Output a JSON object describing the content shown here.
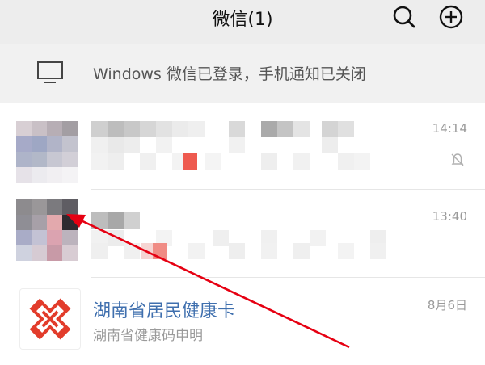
{
  "header": {
    "title": "微信(1)",
    "search_icon": "search-icon",
    "add_icon": "plus-circle-icon"
  },
  "banner": {
    "icon": "monitor-icon",
    "text": "Windows 微信已登录，手机通知已关闭"
  },
  "chats": [
    {
      "time": "14:14",
      "muted": true
    },
    {
      "time": "13:40",
      "muted": false
    },
    {
      "name": "湖南省居民健康卡",
      "preview": "湖南省健康码申明",
      "time": "8月6日",
      "logo": "red-cross-logo"
    }
  ],
  "colors": {
    "header_bg": "#ededed",
    "banner_bg": "#f1f1f1",
    "link_blue": "#3f6fae",
    "accent_red": "#e8463b",
    "annotation_arrow": "#e60012"
  }
}
